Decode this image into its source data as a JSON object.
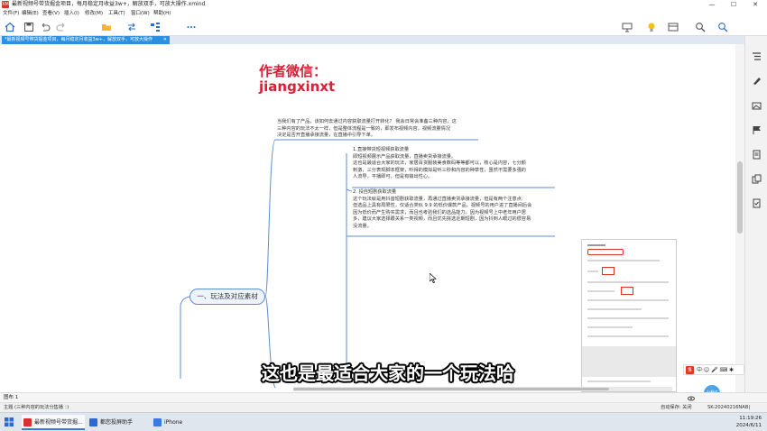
{
  "window": {
    "app_icon": "XM",
    "title": "最新视频号带货掘金项目，每月稳定月收益3w+，解放双手，可放大操作.xmind",
    "minimize": "—",
    "maximize": "☐",
    "close": "✕"
  },
  "menu": [
    "文件(F)",
    "编辑(E)",
    "查看(V)",
    "插入(I)",
    "修改(M)",
    "工具(T)",
    "窗口(W)",
    "帮助(H)"
  ],
  "tab": {
    "label": "*最新视频号带货掘金项目，每月稳定月收益3w+，解放双手，可放大操作",
    "close": "✕"
  },
  "watermark": {
    "line1": "作者微信：",
    "line2": "jiangxinxt"
  },
  "notes": {
    "intro": [
      "当我们有了产品，该如何去通过内容获取流量打开转化？ 我会日常会准备三种内容，这",
      "三种内容的玩法不太一样，但是整体流程是一致的，即发布视频内容，视频流量情况",
      "决定是否开直播承接流量，在直播中引导下单。"
    ],
    "point1": [
      "1.直接带货短视频获取流量",
      "即短视频展示产品获取流量，直播卖货承接流量。",
      "这也是最适合大家的玩法，家居百货服装美食数码等等都可以，核心是内容，七分颜",
      "刺激，三分表现脚本框架，听得的模拟是听三秒和内容的种草性，虽然不需要多强的",
      "人流导，平播即可，但是有输出性心。"
    ],
    "point2": [
      "2. 投自短剧获取流量",
      "这个玩法就是用抖音短剧获取流量，再通过直播卖货承接流量，但是有两个注意点:",
      "但选品上具有局限性，仅适合类似 9.9 的低价爆款产品，视频号的用户进了直播间后会",
      "因为低价而产生购买需求，而且也考验我们的选品能力。因为视频号上中老年用户居",
      "多，建议大家选择跟关系一类视频，而且优先挑选近期短剧，因为抖到人眼过的很容易",
      "没流量。"
    ]
  },
  "topic": "一、玩法及对应素材",
  "subtitle": "这也是最适合大家的一个玩法哈",
  "sheet": {
    "label": "图布 1"
  },
  "status": {
    "left": "主题 (三种内容的玩法分售播 ：)",
    "autosave": "自动保存: 关闭",
    "account": "SK-20240216NAB|"
  },
  "taskbar": {
    "items": [
      {
        "label": "最新视频号带货掘...",
        "color": "#d9312b"
      },
      {
        "label": "都您投屏助手",
        "color": "#2a6bd1"
      },
      {
        "label": "iPhone",
        "color": "#3b7be0"
      }
    ],
    "time": "11:19:26",
    "date": "2024/6/11"
  },
  "ime": {
    "brand": "S",
    "text": "中·☺ 🎤 ⌨ ✱"
  },
  "avatar": "小秋S",
  "colors": {
    "accent": "#2c8fe0",
    "watermark": "#d81f34",
    "topic_border": "#5b8ed6"
  },
  "icons": [
    "home-icon",
    "save-icon",
    "undo-icon",
    "redo-icon",
    "folder-icon",
    "share-icon",
    "map-icon",
    "more-icon",
    "present-icon",
    "idea-icon",
    "layout-icon",
    "search-icon",
    "zoom-icon",
    "outline-icon",
    "format-icon",
    "image-icon",
    "flag-icon",
    "notes-icon",
    "copy-icon",
    "task-icon"
  ]
}
